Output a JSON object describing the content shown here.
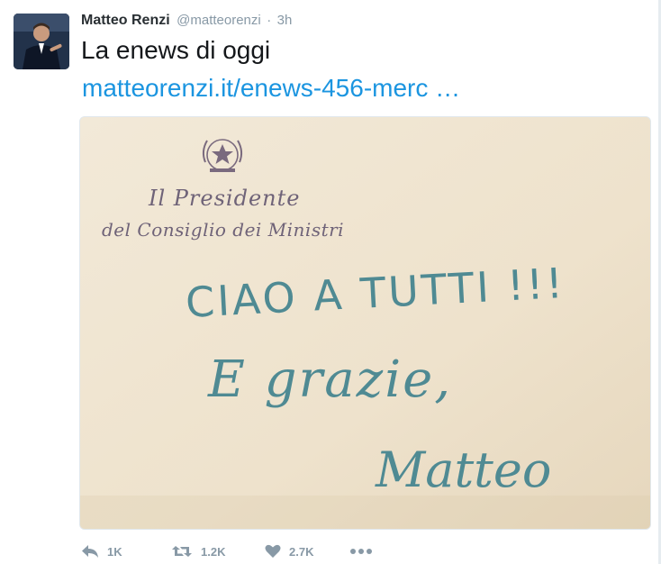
{
  "tweet": {
    "author_name": "Matteo Renzi",
    "author_handle": "@matteorenzi",
    "separator": "·",
    "time": "3h",
    "text": "La enews di oggi",
    "link_text": "matteorenzi.it/enews-456-merc …",
    "media": {
      "letterhead_line1": "Il Presidente",
      "letterhead_line2": "del Consiglio dei Ministri",
      "handwriting_line1": "CIAO A TUTTI !!!",
      "handwriting_line2": "E grazie,",
      "signature": "Matteo",
      "paper_color": "#efe4d1",
      "ink_color": "#4f8a93"
    },
    "actions": {
      "reply_count": "1K",
      "retweet_count": "1.2K",
      "like_count": "2.7K"
    }
  },
  "colors": {
    "link": "#1b95e0",
    "meta": "#8899a6",
    "text": "#14171a"
  }
}
